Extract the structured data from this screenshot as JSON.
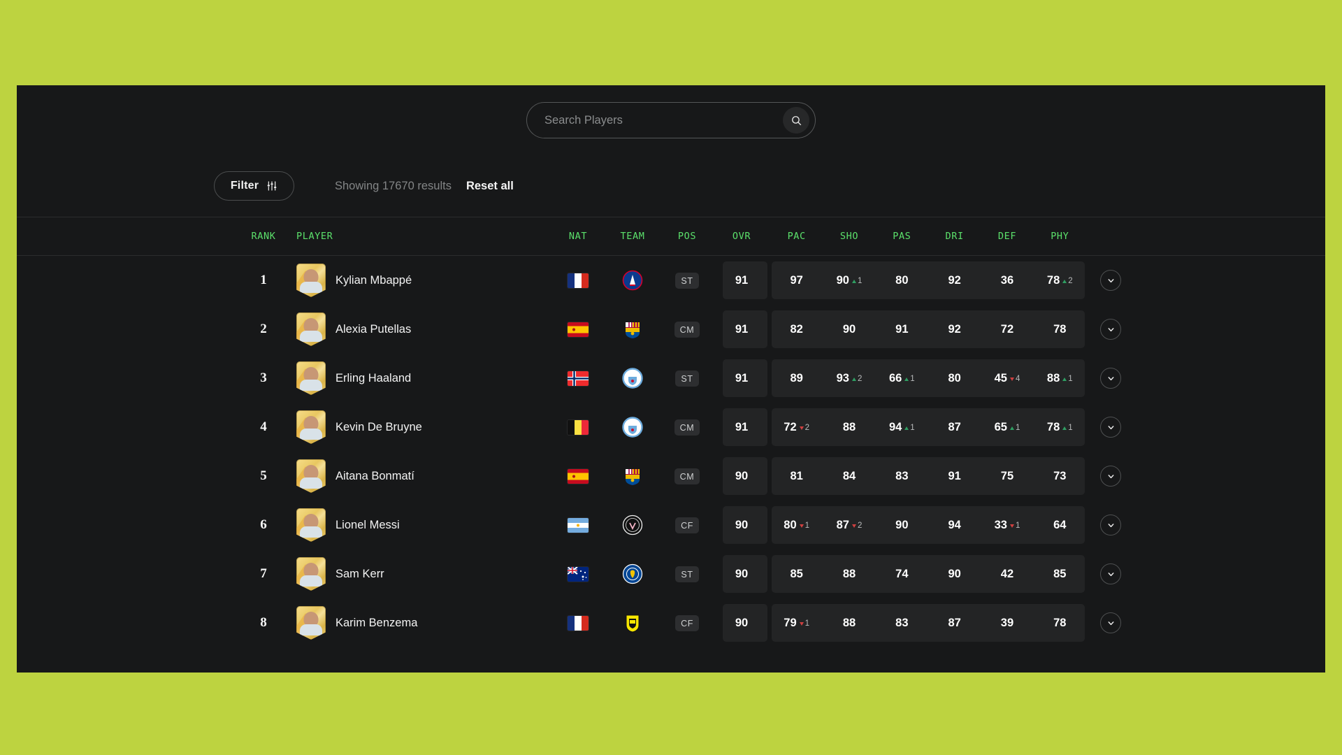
{
  "theme": {
    "page_background": "#bdd340",
    "panel_background": "#171819",
    "header_accent": "#5be06b",
    "stat_up_color": "#2f9e62",
    "stat_down_color": "#cf4040"
  },
  "search": {
    "placeholder": "Search Players",
    "value": "",
    "icon": "search-icon",
    "button_label": ""
  },
  "toolbar": {
    "filter_label": "Filter",
    "filter_icon": "sliders-icon",
    "showing_text": "Showing 17670 results",
    "results_count": 17670,
    "reset_label": "Reset all"
  },
  "table": {
    "columns": [
      {
        "key": "rank",
        "label": "RANK"
      },
      {
        "key": "player",
        "label": "PLAYER"
      },
      {
        "key": "nat",
        "label": "NAT"
      },
      {
        "key": "team",
        "label": "TEAM"
      },
      {
        "key": "pos",
        "label": "POS"
      },
      {
        "key": "ovr",
        "label": "OVR"
      },
      {
        "key": "pac",
        "label": "PAC"
      },
      {
        "key": "sho",
        "label": "SHO"
      },
      {
        "key": "pas",
        "label": "PAS"
      },
      {
        "key": "dri",
        "label": "DRI"
      },
      {
        "key": "def",
        "label": "DEF"
      },
      {
        "key": "phy",
        "label": "PHY"
      }
    ],
    "expand_icon": "chevron-down-icon",
    "rows": [
      {
        "rank": "1",
        "name": "Kylian Mbappé",
        "nation": "France",
        "nation_flag": "flag-france",
        "team": "Paris Saint-Germain",
        "team_crest": "crest-psg",
        "pos": "ST",
        "ovr": "91",
        "stats": [
          {
            "key": "pac",
            "value": "97",
            "delta": null,
            "dir": null
          },
          {
            "key": "sho",
            "value": "90",
            "delta": "1",
            "dir": "up"
          },
          {
            "key": "pas",
            "value": "80",
            "delta": null,
            "dir": null
          },
          {
            "key": "dri",
            "value": "92",
            "delta": null,
            "dir": null
          },
          {
            "key": "def",
            "value": "36",
            "delta": null,
            "dir": null
          },
          {
            "key": "phy",
            "value": "78",
            "delta": "2",
            "dir": "up"
          }
        ]
      },
      {
        "rank": "2",
        "name": "Alexia Putellas",
        "nation": "Spain",
        "nation_flag": "flag-spain",
        "team": "FC Barcelona",
        "team_crest": "crest-barcelona",
        "pos": "CM",
        "ovr": "91",
        "stats": [
          {
            "key": "pac",
            "value": "82",
            "delta": null,
            "dir": null
          },
          {
            "key": "sho",
            "value": "90",
            "delta": null,
            "dir": null
          },
          {
            "key": "pas",
            "value": "91",
            "delta": null,
            "dir": null
          },
          {
            "key": "dri",
            "value": "92",
            "delta": null,
            "dir": null
          },
          {
            "key": "def",
            "value": "72",
            "delta": null,
            "dir": null
          },
          {
            "key": "phy",
            "value": "78",
            "delta": null,
            "dir": null
          }
        ]
      },
      {
        "rank": "3",
        "name": "Erling Haaland",
        "nation": "Norway",
        "nation_flag": "flag-norway",
        "team": "Manchester City",
        "team_crest": "crest-mancity",
        "pos": "ST",
        "ovr": "91",
        "stats": [
          {
            "key": "pac",
            "value": "89",
            "delta": null,
            "dir": null
          },
          {
            "key": "sho",
            "value": "93",
            "delta": "2",
            "dir": "up"
          },
          {
            "key": "pas",
            "value": "66",
            "delta": "1",
            "dir": "up"
          },
          {
            "key": "dri",
            "value": "80",
            "delta": null,
            "dir": null
          },
          {
            "key": "def",
            "value": "45",
            "delta": "4",
            "dir": "down"
          },
          {
            "key": "phy",
            "value": "88",
            "delta": "1",
            "dir": "up"
          }
        ]
      },
      {
        "rank": "4",
        "name": "Kevin De Bruyne",
        "nation": "Belgium",
        "nation_flag": "flag-belgium",
        "team": "Manchester City",
        "team_crest": "crest-mancity",
        "pos": "CM",
        "ovr": "91",
        "stats": [
          {
            "key": "pac",
            "value": "72",
            "delta": "2",
            "dir": "down"
          },
          {
            "key": "sho",
            "value": "88",
            "delta": null,
            "dir": null
          },
          {
            "key": "pas",
            "value": "94",
            "delta": "1",
            "dir": "up"
          },
          {
            "key": "dri",
            "value": "87",
            "delta": null,
            "dir": null
          },
          {
            "key": "def",
            "value": "65",
            "delta": "1",
            "dir": "up"
          },
          {
            "key": "phy",
            "value": "78",
            "delta": "1",
            "dir": "up"
          }
        ]
      },
      {
        "rank": "5",
        "name": "Aitana Bonmatí",
        "nation": "Spain",
        "nation_flag": "flag-spain",
        "team": "FC Barcelona",
        "team_crest": "crest-barcelona",
        "pos": "CM",
        "ovr": "90",
        "stats": [
          {
            "key": "pac",
            "value": "81",
            "delta": null,
            "dir": null
          },
          {
            "key": "sho",
            "value": "84",
            "delta": null,
            "dir": null
          },
          {
            "key": "pas",
            "value": "83",
            "delta": null,
            "dir": null
          },
          {
            "key": "dri",
            "value": "91",
            "delta": null,
            "dir": null
          },
          {
            "key": "def",
            "value": "75",
            "delta": null,
            "dir": null
          },
          {
            "key": "phy",
            "value": "73",
            "delta": null,
            "dir": null
          }
        ]
      },
      {
        "rank": "6",
        "name": "Lionel Messi",
        "nation": "Argentina",
        "nation_flag": "flag-argentina",
        "team": "Inter Miami CF",
        "team_crest": "crest-intermiami",
        "pos": "CF",
        "ovr": "90",
        "stats": [
          {
            "key": "pac",
            "value": "80",
            "delta": "1",
            "dir": "down"
          },
          {
            "key": "sho",
            "value": "87",
            "delta": "2",
            "dir": "down"
          },
          {
            "key": "pas",
            "value": "90",
            "delta": null,
            "dir": null
          },
          {
            "key": "dri",
            "value": "94",
            "delta": null,
            "dir": null
          },
          {
            "key": "def",
            "value": "33",
            "delta": "1",
            "dir": "down"
          },
          {
            "key": "phy",
            "value": "64",
            "delta": null,
            "dir": null
          }
        ]
      },
      {
        "rank": "7",
        "name": "Sam Kerr",
        "nation": "Australia",
        "nation_flag": "flag-australia",
        "team": "Chelsea",
        "team_crest": "crest-chelsea",
        "pos": "ST",
        "ovr": "90",
        "stats": [
          {
            "key": "pac",
            "value": "85",
            "delta": null,
            "dir": null
          },
          {
            "key": "sho",
            "value": "88",
            "delta": null,
            "dir": null
          },
          {
            "key": "pas",
            "value": "74",
            "delta": null,
            "dir": null
          },
          {
            "key": "dri",
            "value": "90",
            "delta": null,
            "dir": null
          },
          {
            "key": "def",
            "value": "42",
            "delta": null,
            "dir": null
          },
          {
            "key": "phy",
            "value": "85",
            "delta": null,
            "dir": null
          }
        ]
      },
      {
        "rank": "8",
        "name": "Karim Benzema",
        "nation": "France",
        "nation_flag": "flag-france",
        "team": "Al-Ittihad",
        "team_crest": "crest-alittihad",
        "pos": "CF",
        "ovr": "90",
        "stats": [
          {
            "key": "pac",
            "value": "79",
            "delta": "1",
            "dir": "down"
          },
          {
            "key": "sho",
            "value": "88",
            "delta": null,
            "dir": null
          },
          {
            "key": "pas",
            "value": "83",
            "delta": null,
            "dir": null
          },
          {
            "key": "dri",
            "value": "87",
            "delta": null,
            "dir": null
          },
          {
            "key": "def",
            "value": "39",
            "delta": null,
            "dir": null
          },
          {
            "key": "phy",
            "value": "78",
            "delta": null,
            "dir": null
          }
        ]
      }
    ]
  }
}
